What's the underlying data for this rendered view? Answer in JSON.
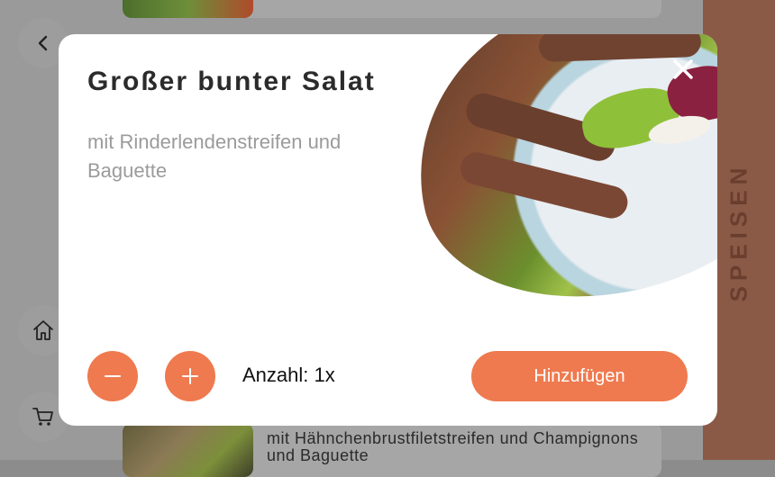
{
  "background": {
    "bottom_card_description": "mit Hähnchenbrustfiletstreifen und Champignons und Baguette"
  },
  "nav": {
    "back_icon": "chevron-left-icon",
    "home_icon": "home-icon",
    "cart_icon": "cart-icon"
  },
  "side_tab": {
    "label": "SPEISEN"
  },
  "modal": {
    "title": "Großer bunter Salat",
    "description": "mit Rinderlendenstreifen und Baguette",
    "close_icon": "close-icon",
    "quantity_label": "Anzahl: 1x",
    "minus_icon": "minus-icon",
    "plus_icon": "plus-icon",
    "add_button_label": "Hinzufügen"
  },
  "colors": {
    "accent": "#ef7a4f",
    "side_tab": "#8a5a46",
    "title": "#2b2b2b",
    "description": "#9b9b9b"
  }
}
